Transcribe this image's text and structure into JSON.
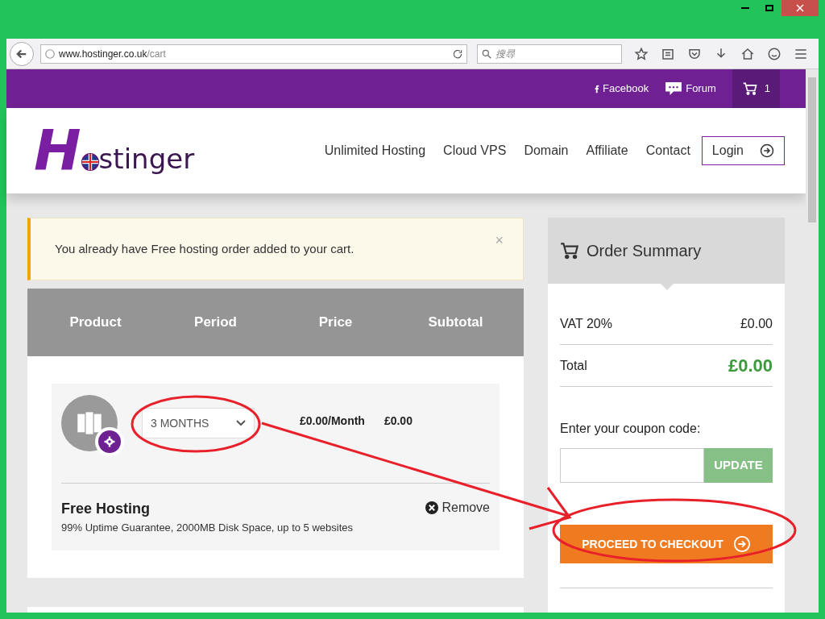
{
  "browser": {
    "url_host": "www.hostinger.co.uk",
    "url_path": "/cart",
    "search_placeholder": "搜尋"
  },
  "topbar": {
    "links": [
      {
        "kind": "facebook",
        "label": "Facebook"
      },
      {
        "kind": "forum",
        "label": "Forum"
      }
    ],
    "cart_count": "1"
  },
  "header": {
    "logo": {
      "first": "H",
      "rest": "stinger"
    },
    "nav": [
      "Unlimited Hosting",
      "Cloud VPS",
      "Domain",
      "Affiliate",
      "Contact"
    ],
    "login": "Login"
  },
  "alert": {
    "message": "You already have Free hosting order added to your cart.",
    "close": "×"
  },
  "cart_table": {
    "columns": [
      "Product",
      "Period",
      "Price",
      "Subtotal"
    ],
    "item": {
      "period": "3 MONTHS",
      "price": "£0.00/Month",
      "subtotal": "£0.00",
      "name": "Free Hosting",
      "description": "99% Uptime Guarantee, 2000MB Disk Space, up to 5 websites",
      "remove": "Remove"
    }
  },
  "order_summary": {
    "title": "Order Summary",
    "rows": [
      {
        "kind": "vat",
        "label": "VAT 20%",
        "value": "£0.00"
      },
      {
        "kind": "total",
        "label": "Total",
        "value": "£0.00"
      }
    ],
    "coupon_label": "Enter your coupon code:",
    "update": "UPDATE",
    "checkout": "PROCEED TO CHECKOUT"
  }
}
